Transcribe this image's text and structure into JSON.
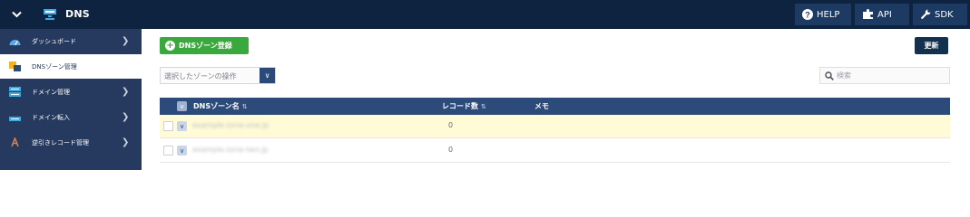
{
  "header": {
    "title": "DNS",
    "help_label": "HELP",
    "api_label": "API",
    "sdk_label": "SDK"
  },
  "sidebar": {
    "items": [
      {
        "label": "ダッシュボード",
        "icon": "dashboard-icon",
        "active": false,
        "has_chevron": true
      },
      {
        "label": "DNSゾーン管理",
        "icon": "dns-zone-icon",
        "active": true,
        "has_chevron": false
      },
      {
        "label": "ドメイン管理",
        "icon": "domain-icon",
        "active": false,
        "has_chevron": true
      },
      {
        "label": "ドメイン転入",
        "icon": "domain-transfer-icon",
        "active": false,
        "has_chevron": true
      },
      {
        "label": "逆引きレコード管理",
        "icon": "reverse-record-icon",
        "active": false,
        "has_chevron": true
      }
    ]
  },
  "toolbar": {
    "add_label": "DNSゾーン登録",
    "refresh_label": "更新",
    "operation_placeholder": "選択したゾーンの操作",
    "search_placeholder": "検索"
  },
  "table": {
    "columns": [
      "DNSゾーン名",
      "レコード数",
      "メモ"
    ],
    "rows": [
      {
        "zone": "example-zone-one.jp",
        "records": "0",
        "memo": ""
      },
      {
        "zone": "example-zone-two.jp",
        "records": "0",
        "memo": ""
      }
    ]
  },
  "colors": {
    "topbar": "#0e2340",
    "sidebar": "#253a5e",
    "accent_green": "#3aa93d",
    "table_header": "#2c4a7a",
    "row_highlight": "#fffbd6"
  }
}
